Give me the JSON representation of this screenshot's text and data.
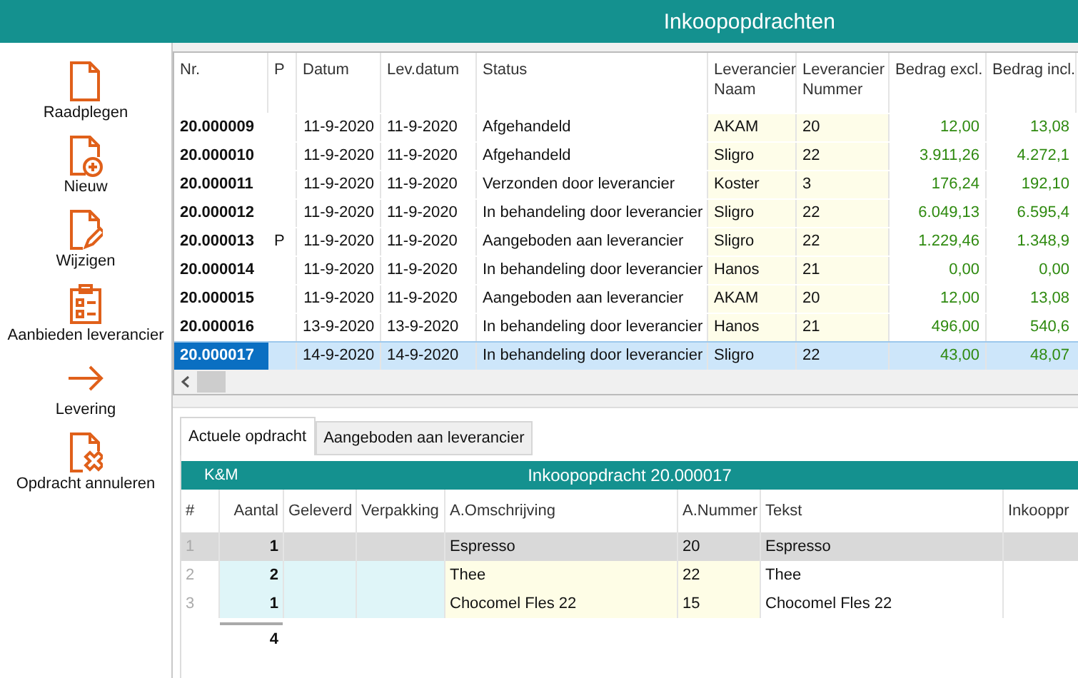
{
  "window": {
    "title": "Inkoopopdrachten"
  },
  "sidebar": {
    "items": [
      {
        "kind": "document",
        "label": "Raadplegen"
      },
      {
        "kind": "document-plus",
        "label": "Nieuw"
      },
      {
        "kind": "document-pencil",
        "label": "Wijzigen"
      },
      {
        "kind": "clipboard",
        "label": "Aanbieden leverancier"
      },
      {
        "kind": "arrow",
        "label": "Levering"
      },
      {
        "kind": "document-x",
        "label": "Opdracht annuleren"
      }
    ]
  },
  "orders": {
    "columns": [
      "Nr.",
      "P",
      "Datum",
      "Lev.datum",
      "Status",
      "Leverancier Naam",
      "Leverancier Nummer",
      "Bedrag excl.",
      "Bedrag incl."
    ],
    "rows": [
      {
        "nr": "20.000009",
        "datum": "11-9-2020",
        "levdatum": "11-9-2020",
        "status": "Afgehandeld",
        "naam": "AKAM",
        "nummer": "20",
        "excl": "12,00",
        "incl": "13,08",
        "selected": false
      },
      {
        "nr": "20.000010",
        "datum": "11-9-2020",
        "levdatum": "11-9-2020",
        "status": "Afgehandeld",
        "naam": "Sligro",
        "nummer": "22",
        "excl": "3.911,26",
        "incl": "4.272,1",
        "selected": false
      },
      {
        "nr": "20.000011",
        "datum": "11-9-2020",
        "levdatum": "11-9-2020",
        "status": "Verzonden door leverancier",
        "naam": "Koster",
        "nummer": "3",
        "excl": "176,24",
        "incl": "192,10",
        "selected": false
      },
      {
        "nr": "20.000012",
        "datum": "11-9-2020",
        "levdatum": "11-9-2020",
        "status": "In behandeling door leverancier",
        "naam": "Sligro",
        "nummer": "22",
        "excl": "6.049,13",
        "incl": "6.595,4",
        "selected": false
      },
      {
        "nr": "20.000013",
        "p": "P",
        "datum": "11-9-2020",
        "levdatum": "11-9-2020",
        "status": "Aangeboden aan leverancier",
        "naam": "Sligro",
        "nummer": "22",
        "excl": "1.229,46",
        "incl": "1.348,9",
        "selected": false
      },
      {
        "nr": "20.000014",
        "datum": "11-9-2020",
        "levdatum": "11-9-2020",
        "status": "In behandeling door leverancier",
        "naam": "Hanos",
        "nummer": "21",
        "excl": "0,00",
        "incl": "0,00",
        "selected": false
      },
      {
        "nr": "20.000015",
        "datum": "11-9-2020",
        "levdatum": "11-9-2020",
        "status": "Aangeboden aan leverancier",
        "naam": "AKAM",
        "nummer": "20",
        "excl": "12,00",
        "incl": "13,08",
        "selected": false
      },
      {
        "nr": "20.000016",
        "datum": "13-9-2020",
        "levdatum": "13-9-2020",
        "status": "In behandeling door leverancier",
        "naam": "Hanos",
        "nummer": "21",
        "excl": "496,00",
        "incl": "540,6",
        "selected": false
      },
      {
        "nr": "20.000017",
        "datum": "14-9-2020",
        "levdatum": "14-9-2020",
        "status": "In behandeling door leverancier",
        "naam": "Sligro",
        "nummer": "22",
        "excl": "43,00",
        "incl": "48,07",
        "selected": true
      }
    ]
  },
  "tabs": [
    {
      "label": "Actuele opdracht",
      "selected": true
    },
    {
      "label": "Aangeboden aan leverancier",
      "selected": false
    }
  ],
  "detail": {
    "company": "K&M",
    "title": "Inkoopopdracht 20.000017",
    "columns": [
      "#",
      "Aantal",
      "Geleverd",
      "Verpakking",
      "A.Omschrijving",
      "A.Nummer",
      "Tekst",
      "Inkooppr"
    ],
    "rows": [
      {
        "index": "1",
        "aantal": "1",
        "omschrijving": "Espresso",
        "nummer": "20",
        "tekst": "Espresso",
        "selected": true
      },
      {
        "index": "2",
        "aantal": "2",
        "omschrijving": "Thee",
        "nummer": "22",
        "tekst": "Thee",
        "selected": false
      },
      {
        "index": "3",
        "aantal": "1",
        "omschrijving": "Chocomel Fles 22",
        "nummer": "15",
        "tekst": "Chocomel Fles 22",
        "selected": false
      }
    ],
    "total": "4"
  }
}
